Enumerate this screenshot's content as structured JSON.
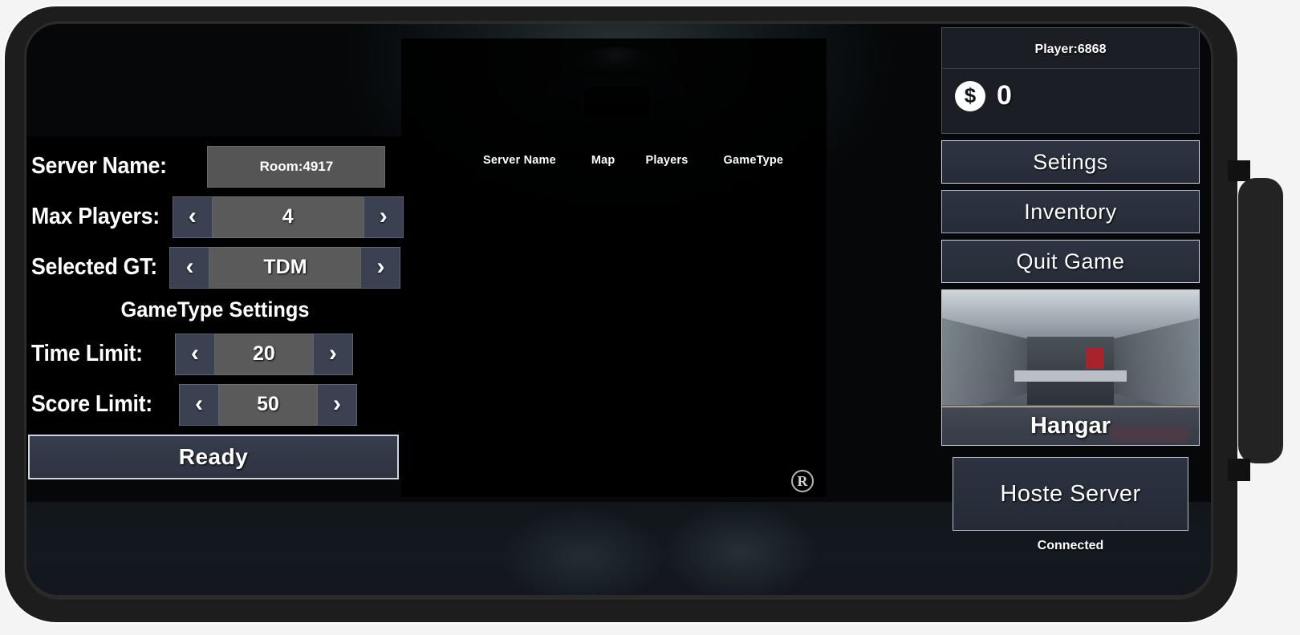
{
  "host_settings": {
    "server_name_label": "Server Name:",
    "server_name_value": "Room:4917",
    "max_players_label": "Max Players:",
    "max_players_value": "4",
    "selected_gt_label": "Selected GT:",
    "selected_gt_value": "TDM",
    "gametype_settings_title": "GameType Settings",
    "time_limit_label": "Time Limit:",
    "time_limit_value": "20",
    "score_limit_label": "Score Limit:",
    "score_limit_value": "50",
    "ready_label": "Ready",
    "prev_arrow": "‹",
    "next_arrow": "›"
  },
  "server_browser": {
    "columns": [
      "Server Name",
      "Map",
      "Players",
      "GameType"
    ],
    "rows": [],
    "watermark": "R"
  },
  "right_panel": {
    "player_id": "Player:6868",
    "currency_icon": "$",
    "currency_amount": "0",
    "settings_label": "Setings",
    "inventory_label": "Inventory",
    "quit_game_label": "Quit Game",
    "map_name": "Hangar",
    "host_server_label": "Hoste Server",
    "connection_status": "Connected"
  },
  "colors": {
    "panel_bg": "#000000",
    "value_field": "#555555",
    "spinner_value": "#5a5a5a",
    "spin_button": "#3b4150",
    "menu_button": "#2e3442",
    "accent_border": "#d8dce4",
    "text": "#ffffff"
  }
}
